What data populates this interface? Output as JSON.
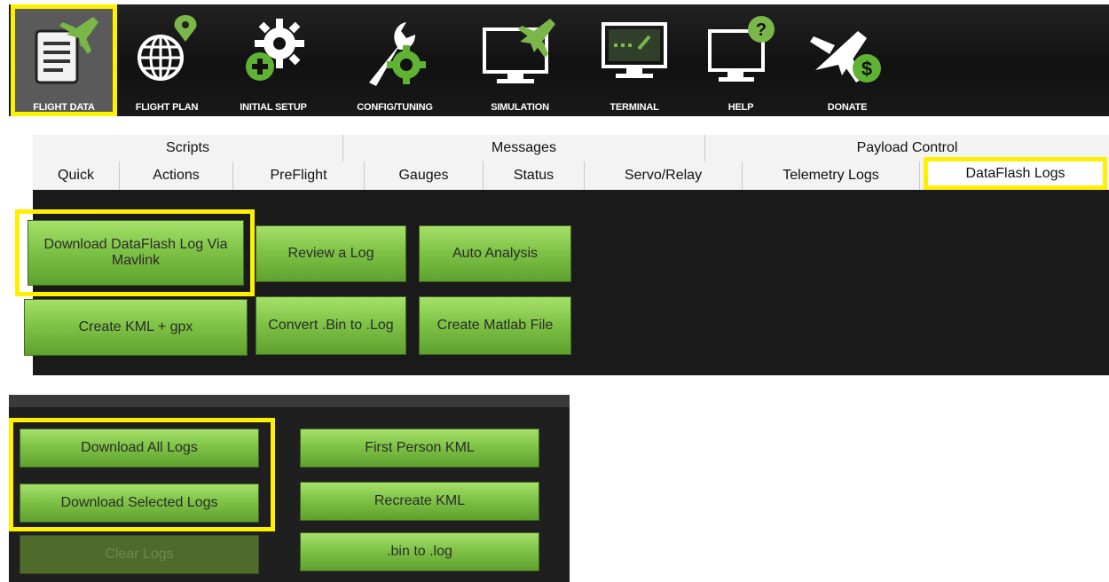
{
  "toolbar": {
    "items": [
      {
        "label": "FLIGHT DATA",
        "icon": "flight-data-icon",
        "active": true
      },
      {
        "label": "FLIGHT PLAN",
        "icon": "flight-plan-icon"
      },
      {
        "label": "INITIAL SETUP",
        "icon": "initial-setup-icon"
      },
      {
        "label": "CONFIG/TUNING",
        "icon": "config-tuning-icon"
      },
      {
        "label": "SIMULATION",
        "icon": "simulation-icon"
      },
      {
        "label": "TERMINAL",
        "icon": "terminal-icon"
      },
      {
        "label": "HELP",
        "icon": "help-icon"
      },
      {
        "label": "DONATE",
        "icon": "donate-icon"
      }
    ],
    "accent": "#7ab648",
    "highlight": "#ffef00"
  },
  "tabs": {
    "row1": [
      "Scripts",
      "Messages",
      "Payload Control"
    ],
    "row2": [
      "Quick",
      "Actions",
      "PreFlight",
      "Gauges",
      "Status",
      "Servo/Relay",
      "Telemetry Logs",
      "DataFlash Logs"
    ],
    "selected": "DataFlash Logs"
  },
  "dataflash": {
    "download_via_mavlink": "Download DataFlash Log Via Mavlink",
    "review_log": "Review a Log",
    "auto_analysis": "Auto Analysis",
    "create_kml_gpx": "Create KML + gpx",
    "convert_bin": "Convert .Bin to .Log",
    "create_matlab": "Create Matlab File"
  },
  "logs": {
    "download_all": "Download All Logs",
    "download_selected": "Download Selected Logs",
    "clear_logs": "Clear Logs",
    "first_person_kml": "First Person KML",
    "recreate_kml": "Recreate KML",
    "bin_to_log": ".bin to .log"
  }
}
